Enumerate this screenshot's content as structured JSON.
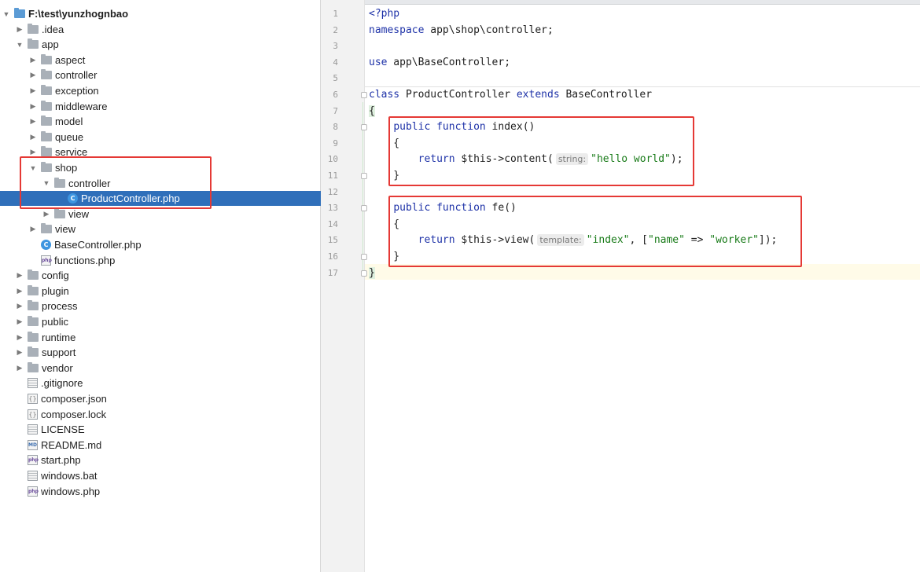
{
  "tree": {
    "items": [
      {
        "label": "F:\\test\\yunzhognbao",
        "depth": 0,
        "arrow": "open",
        "icon": "folder-root",
        "bold": true
      },
      {
        "label": ".idea",
        "depth": 1,
        "arrow": "closed",
        "icon": "folder"
      },
      {
        "label": "app",
        "depth": 1,
        "arrow": "open",
        "icon": "folder"
      },
      {
        "label": "aspect",
        "depth": 2,
        "arrow": "closed",
        "icon": "folder"
      },
      {
        "label": "controller",
        "depth": 2,
        "arrow": "closed",
        "icon": "folder"
      },
      {
        "label": "exception",
        "depth": 2,
        "arrow": "closed",
        "icon": "folder"
      },
      {
        "label": "middleware",
        "depth": 2,
        "arrow": "closed",
        "icon": "folder"
      },
      {
        "label": "model",
        "depth": 2,
        "arrow": "closed",
        "icon": "folder"
      },
      {
        "label": "queue",
        "depth": 2,
        "arrow": "closed",
        "icon": "folder"
      },
      {
        "label": "service",
        "depth": 2,
        "arrow": "closed",
        "icon": "folder"
      },
      {
        "label": "shop",
        "depth": 2,
        "arrow": "open",
        "icon": "folder"
      },
      {
        "label": "controller",
        "depth": 3,
        "arrow": "open",
        "icon": "folder"
      },
      {
        "label": "ProductController.php",
        "depth": 4,
        "arrow": "none",
        "icon": "class-file",
        "selected": true
      },
      {
        "label": "view",
        "depth": 3,
        "arrow": "closed",
        "icon": "folder"
      },
      {
        "label": "view",
        "depth": 2,
        "arrow": "closed",
        "icon": "folder"
      },
      {
        "label": "BaseController.php",
        "depth": 2,
        "arrow": "none",
        "icon": "class-file"
      },
      {
        "label": "functions.php",
        "depth": 2,
        "arrow": "none",
        "icon": "php-file"
      },
      {
        "label": "config",
        "depth": 1,
        "arrow": "closed",
        "icon": "folder"
      },
      {
        "label": "plugin",
        "depth": 1,
        "arrow": "closed",
        "icon": "folder"
      },
      {
        "label": "process",
        "depth": 1,
        "arrow": "closed",
        "icon": "folder"
      },
      {
        "label": "public",
        "depth": 1,
        "arrow": "closed",
        "icon": "folder"
      },
      {
        "label": "runtime",
        "depth": 1,
        "arrow": "closed",
        "icon": "folder"
      },
      {
        "label": "support",
        "depth": 1,
        "arrow": "closed",
        "icon": "folder"
      },
      {
        "label": "vendor",
        "depth": 1,
        "arrow": "closed",
        "icon": "folder"
      },
      {
        "label": ".gitignore",
        "depth": 1,
        "arrow": "none",
        "icon": "generic-file"
      },
      {
        "label": "composer.json",
        "depth": 1,
        "arrow": "none",
        "icon": "config-file"
      },
      {
        "label": "composer.lock",
        "depth": 1,
        "arrow": "none",
        "icon": "config-file"
      },
      {
        "label": "LICENSE",
        "depth": 1,
        "arrow": "none",
        "icon": "generic-file"
      },
      {
        "label": "README.md",
        "depth": 1,
        "arrow": "none",
        "icon": "md-file"
      },
      {
        "label": "start.php",
        "depth": 1,
        "arrow": "none",
        "icon": "php-file"
      },
      {
        "label": "windows.bat",
        "depth": 1,
        "arrow": "none",
        "icon": "generic-file"
      },
      {
        "label": "windows.php",
        "depth": 1,
        "arrow": "none",
        "icon": "php-file"
      }
    ]
  },
  "editor": {
    "line_numbers": [
      "1",
      "2",
      "3",
      "4",
      "5",
      "6",
      "7",
      "8",
      "9",
      "10",
      "11",
      "12",
      "13",
      "14",
      "15",
      "16",
      "17"
    ],
    "current_line": "17",
    "lines": [
      [
        {
          "t": "<?php",
          "c": "kw"
        }
      ],
      [
        {
          "t": "namespace",
          "c": "kw"
        },
        {
          "t": " app\\shop\\controller;",
          "c": "ident"
        }
      ],
      [],
      [
        {
          "t": "use",
          "c": "kw"
        },
        {
          "t": " app\\BaseController;",
          "c": "ident"
        }
      ],
      [],
      [
        {
          "t": "class",
          "c": "kw"
        },
        {
          "t": " ",
          "c": "ident"
        },
        {
          "t": "ProductController",
          "c": "cls"
        },
        {
          "t": " ",
          "c": "ident"
        },
        {
          "t": "extends",
          "c": "kw"
        },
        {
          "t": " BaseController",
          "c": "ident"
        }
      ],
      [
        {
          "t": "{",
          "c": "brace"
        }
      ],
      [
        {
          "t": "    ",
          "c": "ident"
        },
        {
          "t": "public",
          "c": "kw"
        },
        {
          "t": " ",
          "c": "ident"
        },
        {
          "t": "function",
          "c": "kw"
        },
        {
          "t": " index()",
          "c": "ident"
        }
      ],
      [
        {
          "t": "    {",
          "c": "ident"
        }
      ],
      [
        {
          "t": "        ",
          "c": "ident"
        },
        {
          "t": "return",
          "c": "kw"
        },
        {
          "t": " $this->content(",
          "c": "var"
        },
        {
          "t": "string:",
          "c": "hint"
        },
        {
          "t": "\"hello world\"",
          "c": "str"
        },
        {
          "t": ");",
          "c": "ident"
        }
      ],
      [
        {
          "t": "    }",
          "c": "ident"
        }
      ],
      [],
      [
        {
          "t": "    ",
          "c": "ident"
        },
        {
          "t": "public",
          "c": "kw"
        },
        {
          "t": " ",
          "c": "ident"
        },
        {
          "t": "function",
          "c": "kw"
        },
        {
          "t": " fe()",
          "c": "ident"
        }
      ],
      [
        {
          "t": "    {",
          "c": "ident"
        }
      ],
      [
        {
          "t": "        ",
          "c": "ident"
        },
        {
          "t": "return",
          "c": "kw"
        },
        {
          "t": " $this->view(",
          "c": "var"
        },
        {
          "t": "template:",
          "c": "hint"
        },
        {
          "t": "\"index\"",
          "c": "str"
        },
        {
          "t": ", [",
          "c": "ident"
        },
        {
          "t": "\"name\"",
          "c": "str"
        },
        {
          "t": " => ",
          "c": "ident"
        },
        {
          "t": "\"worker\"",
          "c": "str"
        },
        {
          "t": "]);",
          "c": "ident"
        }
      ],
      [
        {
          "t": "    }",
          "c": "ident"
        }
      ],
      [
        {
          "t": "}",
          "c": "brace"
        }
      ]
    ]
  },
  "colors": {
    "selection": "#2f6fba",
    "keyword": "#1f33a8",
    "string": "#177a17",
    "annotation_box": "#e53935"
  }
}
